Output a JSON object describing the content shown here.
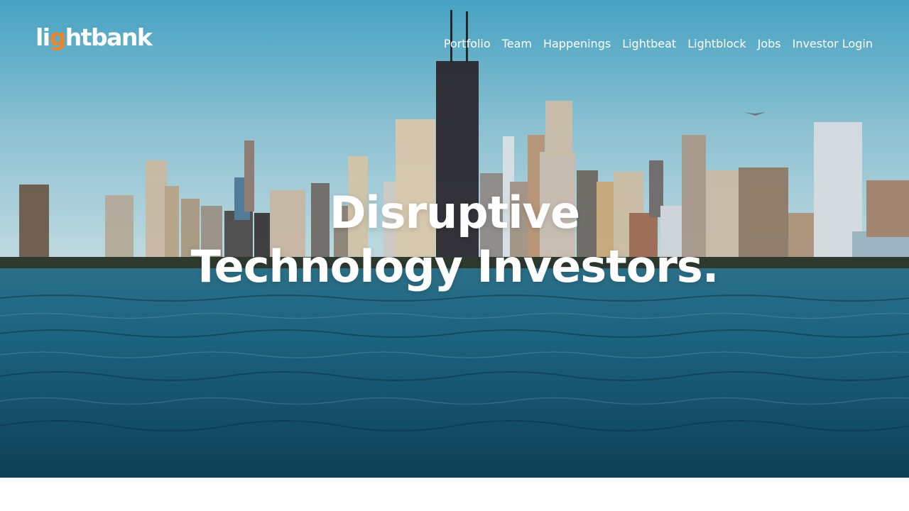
{
  "logo": {
    "prefix": "li",
    "accent": "g",
    "suffix": "htbank"
  },
  "nav": {
    "items": [
      "Portfolio",
      "Team",
      "Happenings",
      "Lightbeat",
      "Lightblock",
      "Jobs",
      "Investor Login"
    ]
  },
  "hero": {
    "line1": "Disruptive",
    "line2": "Technology Investors."
  },
  "colors": {
    "accent": "#e8872c",
    "text": "#ffffff",
    "water": "#15526c",
    "sky": "#7ab8cc"
  }
}
